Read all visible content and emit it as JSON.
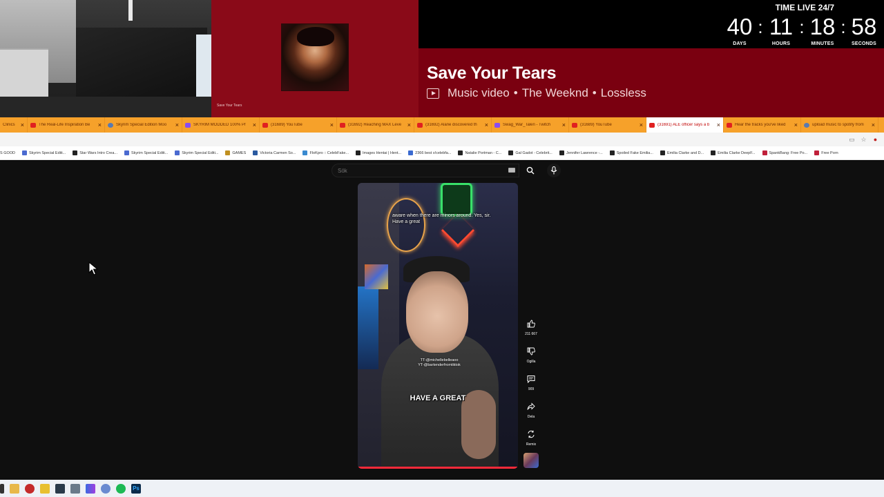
{
  "overlay": {
    "song_title": "Save Your Tears",
    "song_meta": [
      "Music video",
      "The Weeknd",
      "Lossless"
    ],
    "meta_separator": "•",
    "album_small_text": "Save Your Tears",
    "countdown_title": "TIME LIVE 24/7",
    "countdown": [
      {
        "value": "40",
        "label": "DAYS"
      },
      {
        "value": "11",
        "label": "HOURS"
      },
      {
        "value": "18",
        "label": "MINUTES"
      },
      {
        "value": "58",
        "label": "SECONDS"
      }
    ],
    "countdown_separator": ":"
  },
  "tabs": [
    {
      "title": "Clinics",
      "favicon": "gray"
    },
    {
      "title": "The Real-Life Inspiration Be",
      "favicon": "red"
    },
    {
      "title": "Skyrim Special Edition Moo",
      "favicon": "gray"
    },
    {
      "title": "SKYRIM MODDED 100% Pr",
      "favicon": "purple"
    },
    {
      "title": "(31689) YouTube",
      "favicon": "red"
    },
    {
      "title": "(31692) Reaching MAX Leve",
      "favicon": "red"
    },
    {
      "title": "(31692) Alane discovered th",
      "favicon": "red"
    },
    {
      "title": "Swag_War_Talen - Twitch",
      "favicon": "purple"
    },
    {
      "title": "(31689) YouTube",
      "favicon": "red"
    },
    {
      "title": "(31691) ALE officer says a b",
      "favicon": "red",
      "active": true
    },
    {
      "title": "Hear the tracks you've liked",
      "favicon": "red"
    },
    {
      "title": "upload music to spotify from",
      "favicon": "gray"
    }
  ],
  "bookmarks": [
    "S GOOD",
    "Skyrim Special Editi...",
    "Star Wars Intro Crea...",
    "Skyrim Special Editi...",
    "Skyrim Special Editi...",
    "GAMES",
    "Victoria Carmen So...",
    "FloKpro :: CelebFake...",
    "Images Hentai | Hent...",
    "2366 best s!celebfa...",
    "Natalie Portman - C...",
    "Gal Gadot - Celebrit...",
    "Jennifer Lawrence -...",
    "Spoiled Fake Emilia...",
    "Emilia Clarke and D...",
    "Emilia Clarke DeepF...",
    "SpankBang: Free Po...",
    "Free Porn"
  ],
  "search": {
    "placeholder": "Sök"
  },
  "short": {
    "caption_top": "aware when there are minors around. Yes, sir. Have a great",
    "watermark": "TT-@michellebelleaoo\nYT-@bartenderfromtiktok",
    "caption_big": "HAVE A GREAT",
    "actions": [
      {
        "icon": "thumbs-up-icon",
        "label": "211 667"
      },
      {
        "icon": "thumbs-down-icon",
        "label": "Ogilla"
      },
      {
        "icon": "comment-icon",
        "label": "909"
      },
      {
        "icon": "share-icon",
        "label": "Dela"
      },
      {
        "icon": "remix-icon",
        "label": "Remix"
      }
    ]
  },
  "colors": {
    "accent_red": "#ff2a3a",
    "music_band": "#7a0010",
    "tabbar": "#f6a12a"
  }
}
